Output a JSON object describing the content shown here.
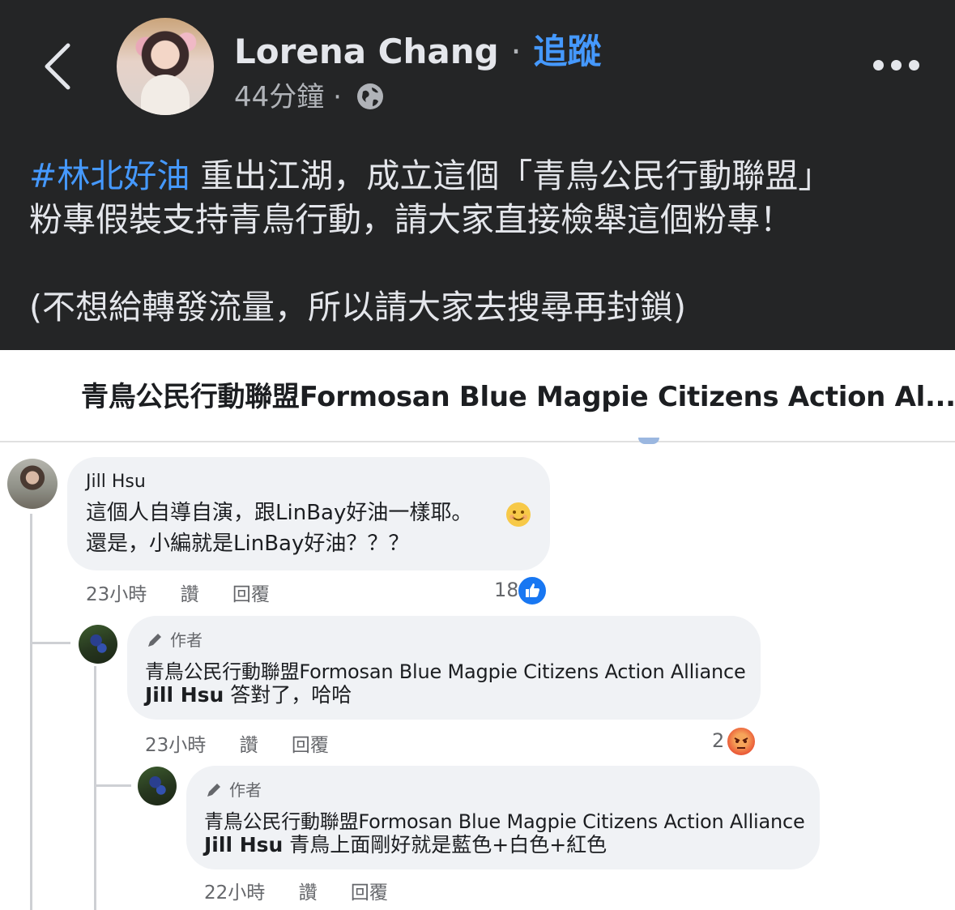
{
  "post": {
    "author": "Lorena Chang",
    "separator": "·",
    "follow_label": "追蹤",
    "time": "44分鐘",
    "time_separator": "·",
    "hashtag": "#林北好油",
    "line1_rest": " 重出江湖，成立這個「青鳥公民行動聯盟」",
    "line2": "粉專假裝支持青鳥行動，請大家直接檢舉這個粉專！",
    "line3": "(不想給轉發流量，所以請大家去搜尋再封鎖)",
    "icons": {
      "back": "chevron-left-icon",
      "privacy": "globe-icon",
      "more": "more-options-icon"
    }
  },
  "screenshot": {
    "page_title": "青鳥公民行動聯盟Formosan Blue Magpie Citizens Action Al...",
    "comments": [
      {
        "name": "Jill Hsu",
        "line1": "這個人自導自演，跟LinBay好油一樣耶。",
        "line2": "還是，小編就是LinBay好油？？？",
        "time": "23小時",
        "read": "讚",
        "reply": "回覆",
        "reaction_count": "18",
        "reaction": "like"
      },
      {
        "badge": "作者",
        "name": "青鳥公民行動聯盟Formosan Blue Magpie Citizens Action Alliance",
        "mention": "Jill Hsu",
        "text": " 答對了，哈哈",
        "time": "23小時",
        "read": "讚",
        "reply": "回覆",
        "reaction_count": "2",
        "reaction": "angry"
      },
      {
        "badge": "作者",
        "name": "青鳥公民行動聯盟Formosan Blue Magpie Citizens Action Alliance",
        "mention": "Jill Hsu",
        "text": " 青鳥上面剛好就是藍色+白色+紅色",
        "time": "22小時",
        "read": "讚",
        "reply": "回覆"
      }
    ]
  },
  "colors": {
    "dark_bg": "#242526",
    "link_blue": "#4599ff",
    "bubble": "#f0f2f5",
    "like_blue": "#1877f2"
  }
}
